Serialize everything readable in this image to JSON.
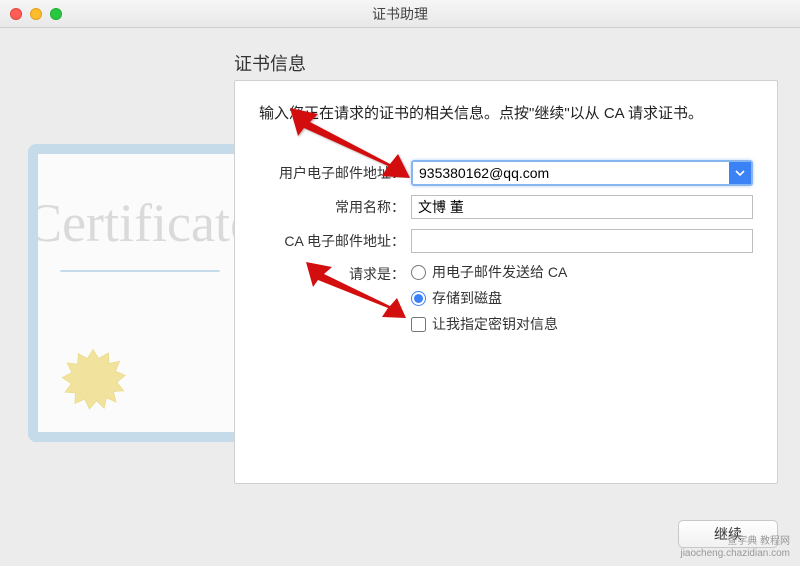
{
  "window": {
    "title": "证书助理"
  },
  "heading": "证书信息",
  "instructions": "输入您正在请求的证书的相关信息。点按\"继续\"以从 CA 请求证书。",
  "form": {
    "email_label": "用户电子邮件地址：",
    "email_value": "935380162@qq.com",
    "common_name_label": "常用名称：",
    "common_name_value": "文博 董",
    "ca_email_label": "CA 电子邮件地址：",
    "ca_email_value": "",
    "request_label": "请求是：",
    "radio_email_ca": "用电子邮件发送给 CA",
    "radio_save_disk": "存储到磁盘",
    "check_keypair": "让我指定密钥对信息",
    "selected_radio": "save_disk",
    "keypair_checked": false
  },
  "buttons": {
    "continue": "继续"
  },
  "decor": {
    "cert_text": "Certificate"
  },
  "watermark": {
    "line1": "查字典 教程网",
    "line2": "jiaocheng.chazidian.com"
  }
}
